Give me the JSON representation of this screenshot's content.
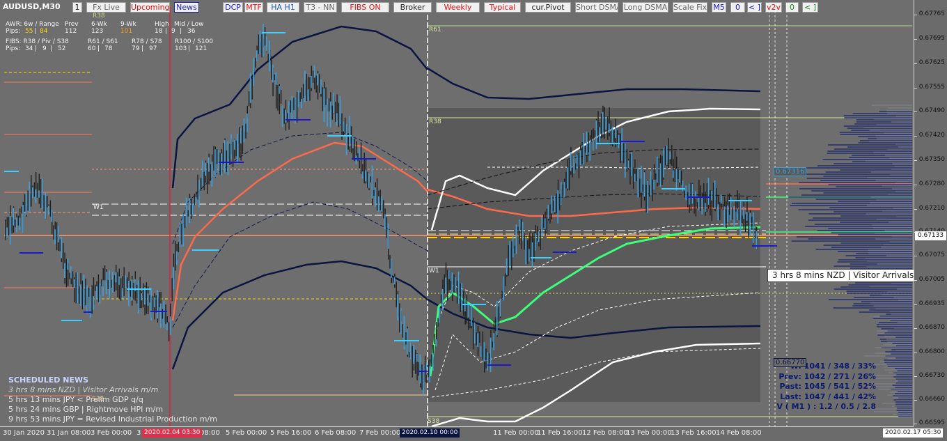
{
  "symbol": "AUDUSD,M30",
  "toolbar": [
    {
      "label": "1",
      "color": "#222222"
    },
    {
      "label": "Fx Live",
      "color": "#666666"
    },
    {
      "label": "Upcoming",
      "color": "#e01010"
    },
    {
      "label": "News",
      "color": "#1a1acc"
    },
    {
      "label": "DCP",
      "color": "#1a1acc"
    },
    {
      "label": "MTF",
      "color": "#e01010"
    },
    {
      "label": "HA H1",
      "color": "#1a5ccc"
    },
    {
      "label": "T3 - NN",
      "color": "#666666"
    },
    {
      "label": "FIBS ON",
      "color": "#e01010"
    },
    {
      "label": "Broker",
      "color": "#222222"
    },
    {
      "label": "Weekly",
      "color": "#e01010"
    },
    {
      "label": "Typical",
      "color": "#e01010"
    },
    {
      "label": "cur.Pivot",
      "color": "#222222"
    },
    {
      "label": "Short DSMA",
      "color": "#666666"
    },
    {
      "label": "Long DSMA",
      "color": "#666666"
    },
    {
      "label": "Scale Fix",
      "color": "#666666"
    },
    {
      "label": "M5",
      "color": "#1a1acc"
    },
    {
      "label": "0",
      "color": "#1a1acc"
    },
    {
      "label": "< ]",
      "color": "#1a1acc"
    },
    {
      "label": "v2v",
      "color": "#e01010"
    },
    {
      "label": "0",
      "color": "#1a8a1a"
    },
    {
      "label": "< ]",
      "color": "#1a8a1a"
    }
  ],
  "info": {
    "r38_tag": "R38",
    "awr_label": "AWR: 6w / Range",
    "prev_label": "Prev",
    "wk6_label": "6-Wk",
    "wk9_label": "9-Wk",
    "high_label": "High",
    "midlow_label": "Mid / Low",
    "pips_label": "Pips:",
    "pips_awr_a": "55",
    "pips_awr_b": "84",
    "pips_prev": "112",
    "pips_6wk": "123",
    "pips_9wk": "101",
    "pips_high": "18",
    "pips_mid": "9",
    "pips_low": "36",
    "fibs_label": "FIBS: R38 / Piv / S38",
    "r61_label": "R61 / S61",
    "r78_label": "R78 / S78",
    "r100_label": "R100 / S100",
    "fpips_label": "Pips:",
    "fpips_a": "34",
    "fpips_b": "9",
    "fpips_c": "52",
    "fpips_d": "60",
    "fpips_e": "78",
    "fpips_f": "79",
    "fpips_g": "97",
    "fpips_h": "103",
    "fpips_i": "121"
  },
  "chart_labels": {
    "w1_left": "W1",
    "r61": "R61",
    "r38": "R38",
    "w1_right": "W1",
    "s38": "S38",
    "s38_low": "S38"
  },
  "news": {
    "header": "SCHEDULED NEWS",
    "items": [
      "3 hrs 8 mins  NZD  |  Visitor Arrivals m/m",
      "5 hrs 13 mins  JPY  <  Prelim GDP q/q",
      "5 hrs 24 mins  GBP  |  Rightmove HPI m/m",
      "9 hrs 53 mins  JPY  =  Revised Industrial Production m/m"
    ]
  },
  "tooltip": "3 hrs 8 mins  NZD  |  Visitor Arrivals m/m",
  "stats": [
    "W: 1041 / 348 / 33%",
    "Prev: 1042 / 271 / 26%",
    "Past: 1045 / 541 / 52%",
    "Last: 1047 / 441 / 42%",
    "V ( M1 ) : 1.2 / 0.5 / 2.8"
  ],
  "price_scale": [
    "0.67765",
    "0.67695",
    "0.67625",
    "0.67555",
    "0.67490",
    "0.67420",
    "0.67350",
    "0.67280",
    "0.67210",
    "0.67140",
    "0.67075",
    "0.67005",
    "0.66935",
    "0.66870",
    "0.66800",
    "0.66730",
    "0.66660",
    "0.66595"
  ],
  "current_price": "0.67133",
  "price_tag_upper": "0.67316",
  "price_tag_lower": "0.66770",
  "time_axis": [
    "30 Jan 2020",
    "31 Jan 08:00",
    "3 Feb 00:00",
    "3",
    "08:00",
    "5 Feb 00:00",
    "5 Feb 16:00",
    "6 Feb 08:00",
    "7 Feb 00:00",
    "Feb 08:00",
    "11 Feb 00:00",
    "11 Feb 16:00",
    "12 Feb 08:00",
    "13 Feb 00:00",
    "13 Feb 16:00",
    "14 Feb 08:00"
  ],
  "time_tag_1": "2020.02.04 03:30",
  "time_tag_2": "2020.02.10 00:00",
  "time_tag_right": "2020.02.17 05:30",
  "colors": {
    "background": "#6e6e6e",
    "candles": "#1e1e1e",
    "ha_bars": "#3aa0e0",
    "dark_band": "#0a1440",
    "white_band": "#ffffff",
    "tma_red": "#ff6a4a",
    "tma_green": "#3cff7a",
    "yellow_line": "#ffd200"
  }
}
